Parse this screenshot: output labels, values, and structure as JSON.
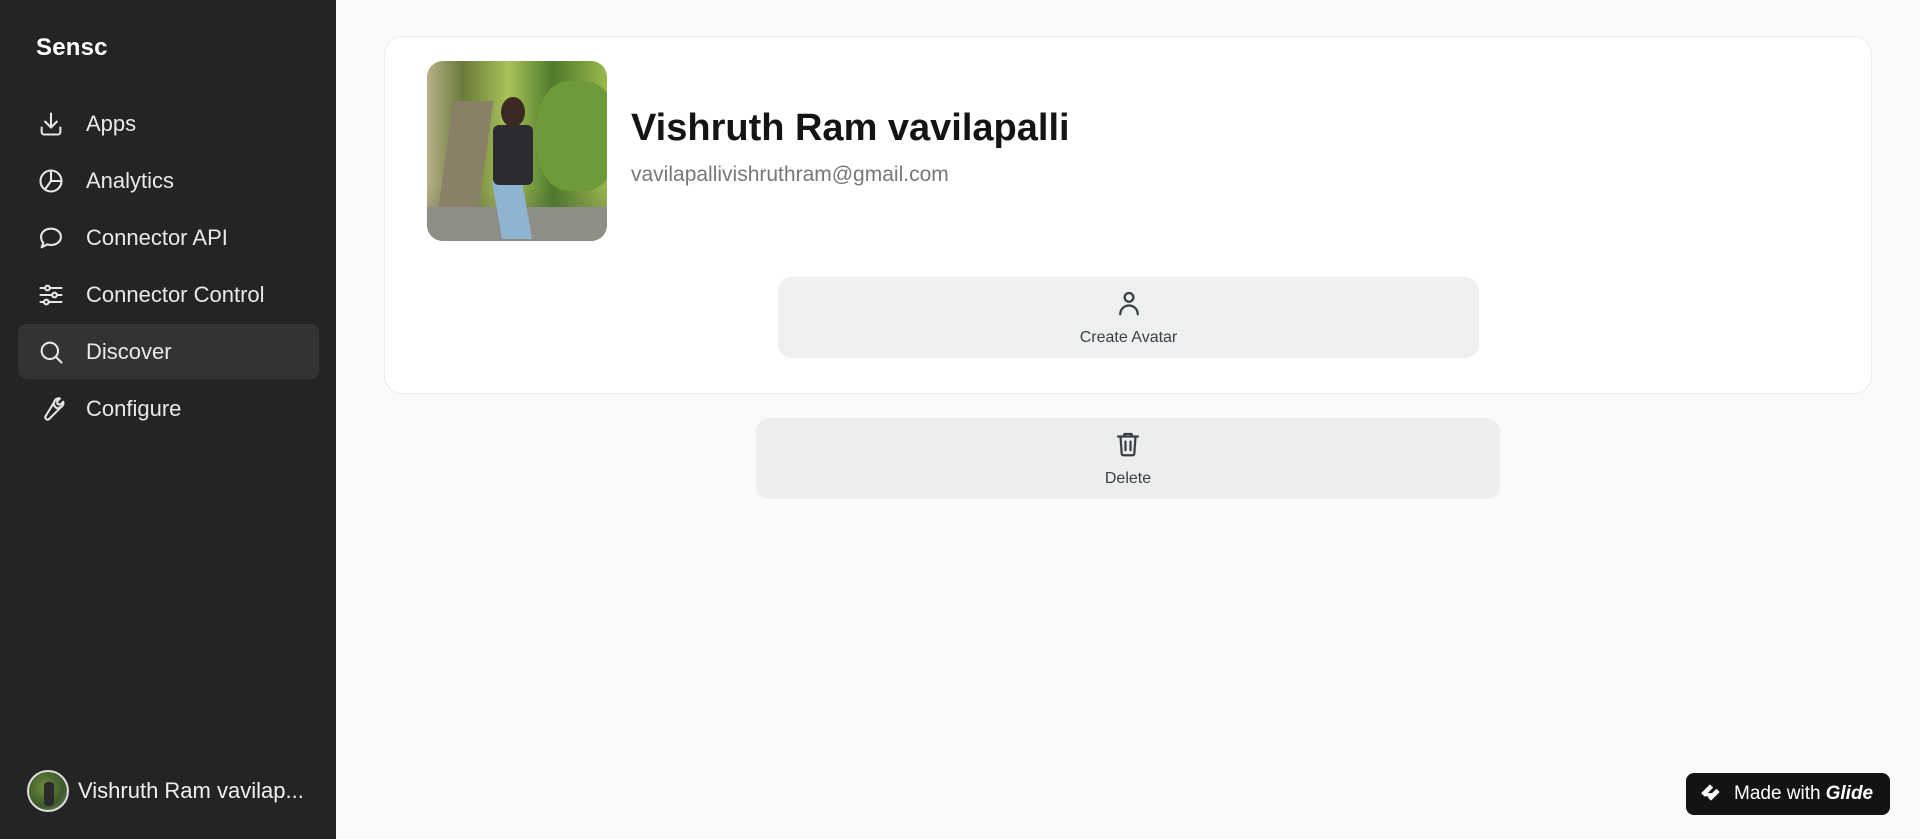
{
  "sidebar": {
    "brand": "Sensc",
    "items": [
      {
        "label": "Apps",
        "icon": "download-icon"
      },
      {
        "label": "Analytics",
        "icon": "pie-chart-icon"
      },
      {
        "label": "Connector API",
        "icon": "chat-bubble-icon"
      },
      {
        "label": "Connector Control",
        "icon": "sliders-icon"
      },
      {
        "label": "Discover",
        "icon": "search-icon",
        "active": true
      },
      {
        "label": "Configure",
        "icon": "wrench-icon"
      }
    ],
    "user_name": "Vishruth Ram vavilap..."
  },
  "profile": {
    "name": "Vishruth Ram vavilapalli",
    "email": "vavilapallivishruthram@gmail.com"
  },
  "actions": {
    "create_avatar_label": "Create Avatar",
    "delete_label": "Delete"
  },
  "badge": {
    "made_with": "Made with",
    "brand": "Glide"
  },
  "colors": {
    "sidebar_bg": "#242424",
    "active_item_bg": "#333333",
    "page_bg": "#f9fafa",
    "button_bg": "#eef0f0",
    "badge_bg": "#131313"
  }
}
